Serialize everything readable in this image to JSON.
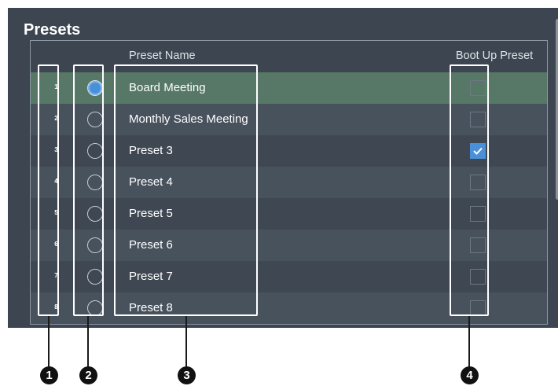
{
  "panel": {
    "title": "Presets"
  },
  "columns": {
    "preset_name": "Preset Name",
    "boot_up": "Boot Up Preset"
  },
  "presets": [
    {
      "num": "1",
      "name": "Board Meeting",
      "selected": true,
      "boot_up": false
    },
    {
      "num": "2",
      "name": "Monthly Sales Meeting",
      "selected": false,
      "boot_up": false
    },
    {
      "num": "3",
      "name": "Preset 3",
      "selected": false,
      "boot_up": true
    },
    {
      "num": "4",
      "name": "Preset 4",
      "selected": false,
      "boot_up": false
    },
    {
      "num": "5",
      "name": "Preset 5",
      "selected": false,
      "boot_up": false
    },
    {
      "num": "6",
      "name": "Preset 6",
      "selected": false,
      "boot_up": false
    },
    {
      "num": "7",
      "name": "Preset 7",
      "selected": false,
      "boot_up": false
    },
    {
      "num": "8",
      "name": "Preset 8",
      "selected": false,
      "boot_up": false
    }
  ],
  "callouts": [
    "1",
    "2",
    "3",
    "4"
  ],
  "colors": {
    "selected_row": "#577866",
    "accent": "#4a90d9",
    "panel_bg": "#3d4650"
  }
}
